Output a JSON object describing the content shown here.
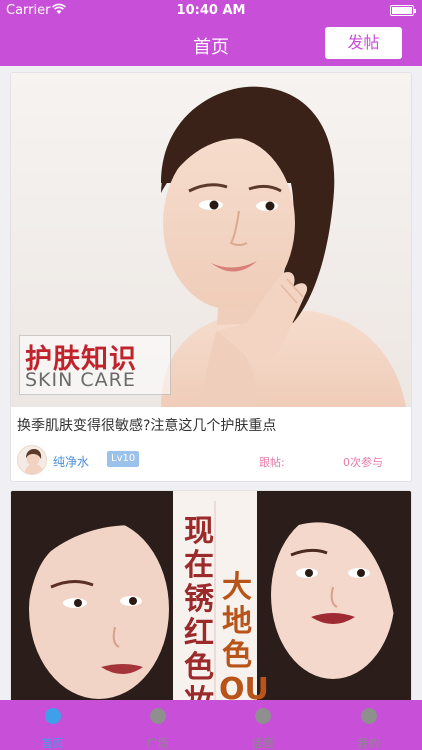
{
  "status_bar": {
    "carrier": "Carrier",
    "time": "10:40 AM",
    "battery_level": 1.0
  },
  "nav": {
    "title": "首页",
    "post_button": "发帖"
  },
  "feed": {
    "posts": [
      {
        "image_caption_cn": "护肤知识",
        "image_caption_en": "SKIN CARE",
        "title": "换季肌肤变得很敏感?注意这几个护肤重点",
        "author": "纯净水",
        "level": "Lv10",
        "follow_label": "跟帖:",
        "join_count": "0次参与"
      },
      {
        "poster_text_a": "现在锈红色妆容",
        "poster_text_b": "大地色OU"
      }
    ]
  },
  "tab_bar": {
    "tabs": [
      {
        "label": "首页",
        "icon": "home-icon",
        "active": true
      },
      {
        "label": "广场",
        "icon": "bulb-icon",
        "active": false
      },
      {
        "label": "话题",
        "icon": "pencil-icon",
        "active": false
      },
      {
        "label": "我的",
        "icon": "gear-icon",
        "active": false
      }
    ]
  },
  "colors": {
    "brand": "#c84fd8",
    "accent": "#3ea0e8",
    "link": "#4a8fd8",
    "pink": "#e67ba6"
  }
}
